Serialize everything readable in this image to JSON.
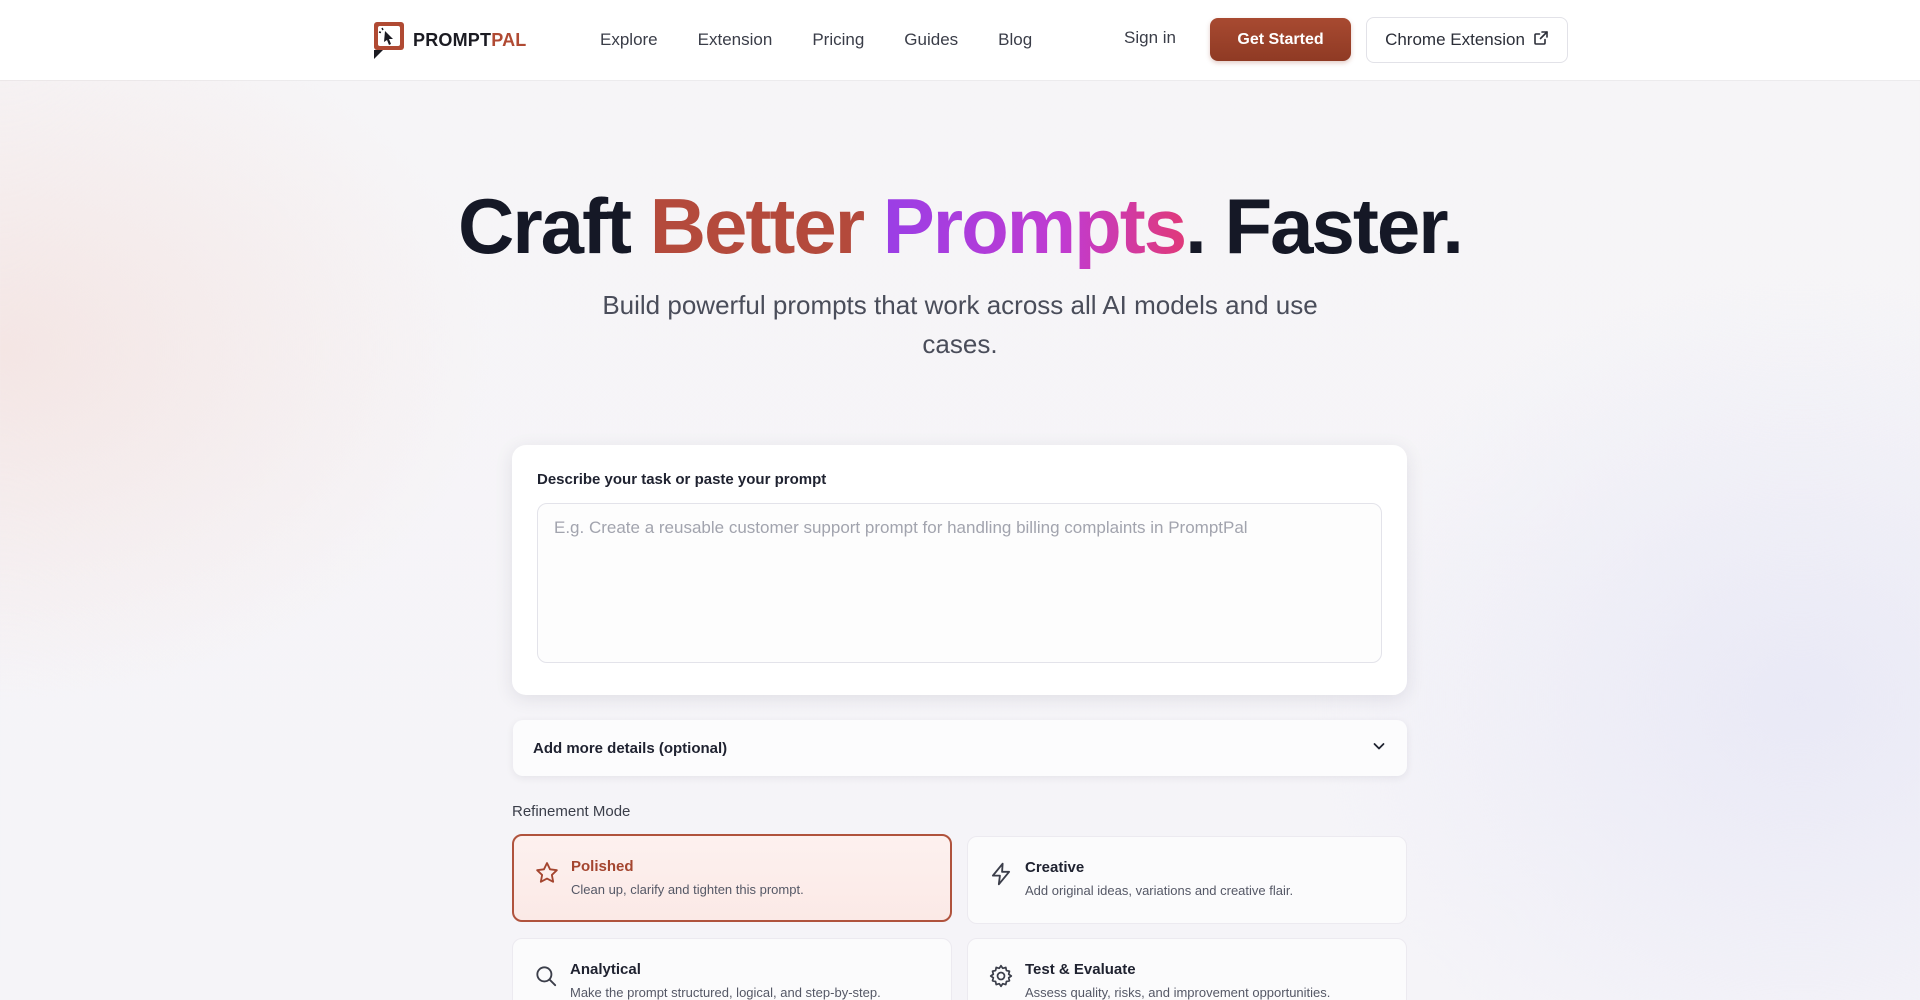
{
  "nav": {
    "logo": {
      "part1": "PROMPT",
      "part2": "PAL"
    },
    "links": [
      "Explore",
      "Extension",
      "Pricing",
      "Guides",
      "Blog"
    ],
    "signin": "Sign in",
    "get_started": "Get Started",
    "chrome_extension": "Chrome Extension"
  },
  "hero": {
    "title_part1": "Craft ",
    "title_better": "Better",
    "title_prompts": "Prompts",
    "title_part2": ". Faster.",
    "subtitle": "Build powerful prompts that work across all AI models and use cases."
  },
  "prompt_card": {
    "label": "Describe your task or paste your prompt",
    "placeholder": "E.g. Create a reusable customer support prompt for handling billing complaints in PromptPal"
  },
  "details": {
    "label": "Add more details (optional)"
  },
  "refinement": {
    "title": "Refinement Mode",
    "modes": [
      {
        "name": "Polished",
        "desc": "Clean up, clarify and tighten this prompt.",
        "icon": "star-icon",
        "selected": true
      },
      {
        "name": "Creative",
        "desc": "Add original ideas, variations and creative flair.",
        "icon": "lightning-icon",
        "selected": false
      },
      {
        "name": "Analytical",
        "desc": "Make the prompt structured, logical, and step-by-step.",
        "icon": "search-icon",
        "selected": false
      },
      {
        "name": "Test & Evaluate",
        "desc": "Assess quality, risks, and improvement opportunities.",
        "icon": "gear-icon",
        "selected": false
      }
    ]
  },
  "colors": {
    "accent": "#a84a31",
    "accent_text": "#b04a33"
  }
}
